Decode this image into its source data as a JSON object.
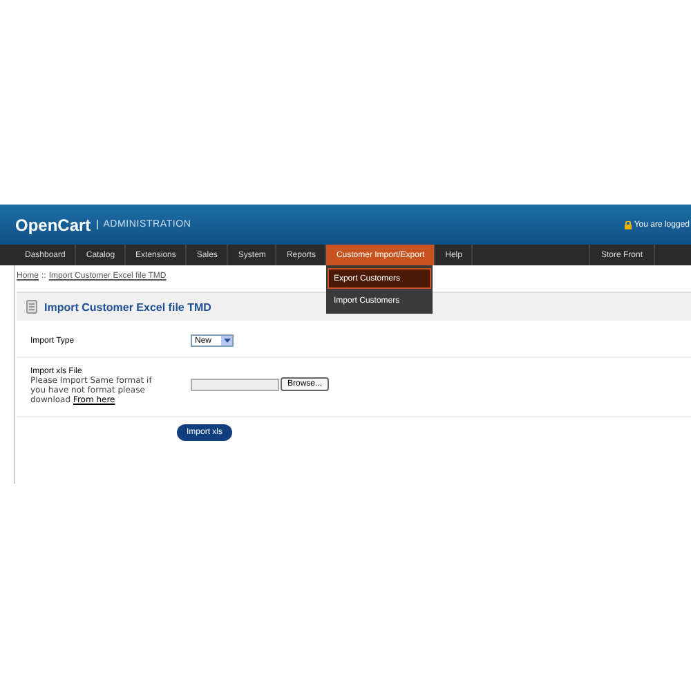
{
  "header": {
    "logo": "OpenCart",
    "subtitle": "ADMINISTRATION",
    "login": "You are logged"
  },
  "nav": {
    "items": [
      {
        "label": "Dashboard",
        "selected": false
      },
      {
        "label": "Catalog",
        "selected": false
      },
      {
        "label": "Extensions",
        "selected": false
      },
      {
        "label": "Sales",
        "selected": false
      },
      {
        "label": "System",
        "selected": false
      },
      {
        "label": "Reports",
        "selected": false
      },
      {
        "label": "Customer Import/Export",
        "selected": true
      },
      {
        "label": "Help",
        "selected": false
      }
    ],
    "right": "Store Front",
    "dropdown": [
      {
        "label": "Export Customers",
        "selected": true
      },
      {
        "label": "Import Customers",
        "selected": false
      }
    ]
  },
  "breadcrumb": [
    {
      "label": "Home"
    },
    {
      "label": "Import Customer Excel file TMD"
    }
  ],
  "breadcrumb_separator": "::",
  "panel": {
    "title": "Import Customer Excel file TMD",
    "import_type": {
      "label": "Import Type",
      "value": "New"
    },
    "file": {
      "label": "Import xls File",
      "help": "Please Import Same format if you have not format please download",
      "link": "From here",
      "browse": "Browse..."
    },
    "submit": "Import xls"
  }
}
